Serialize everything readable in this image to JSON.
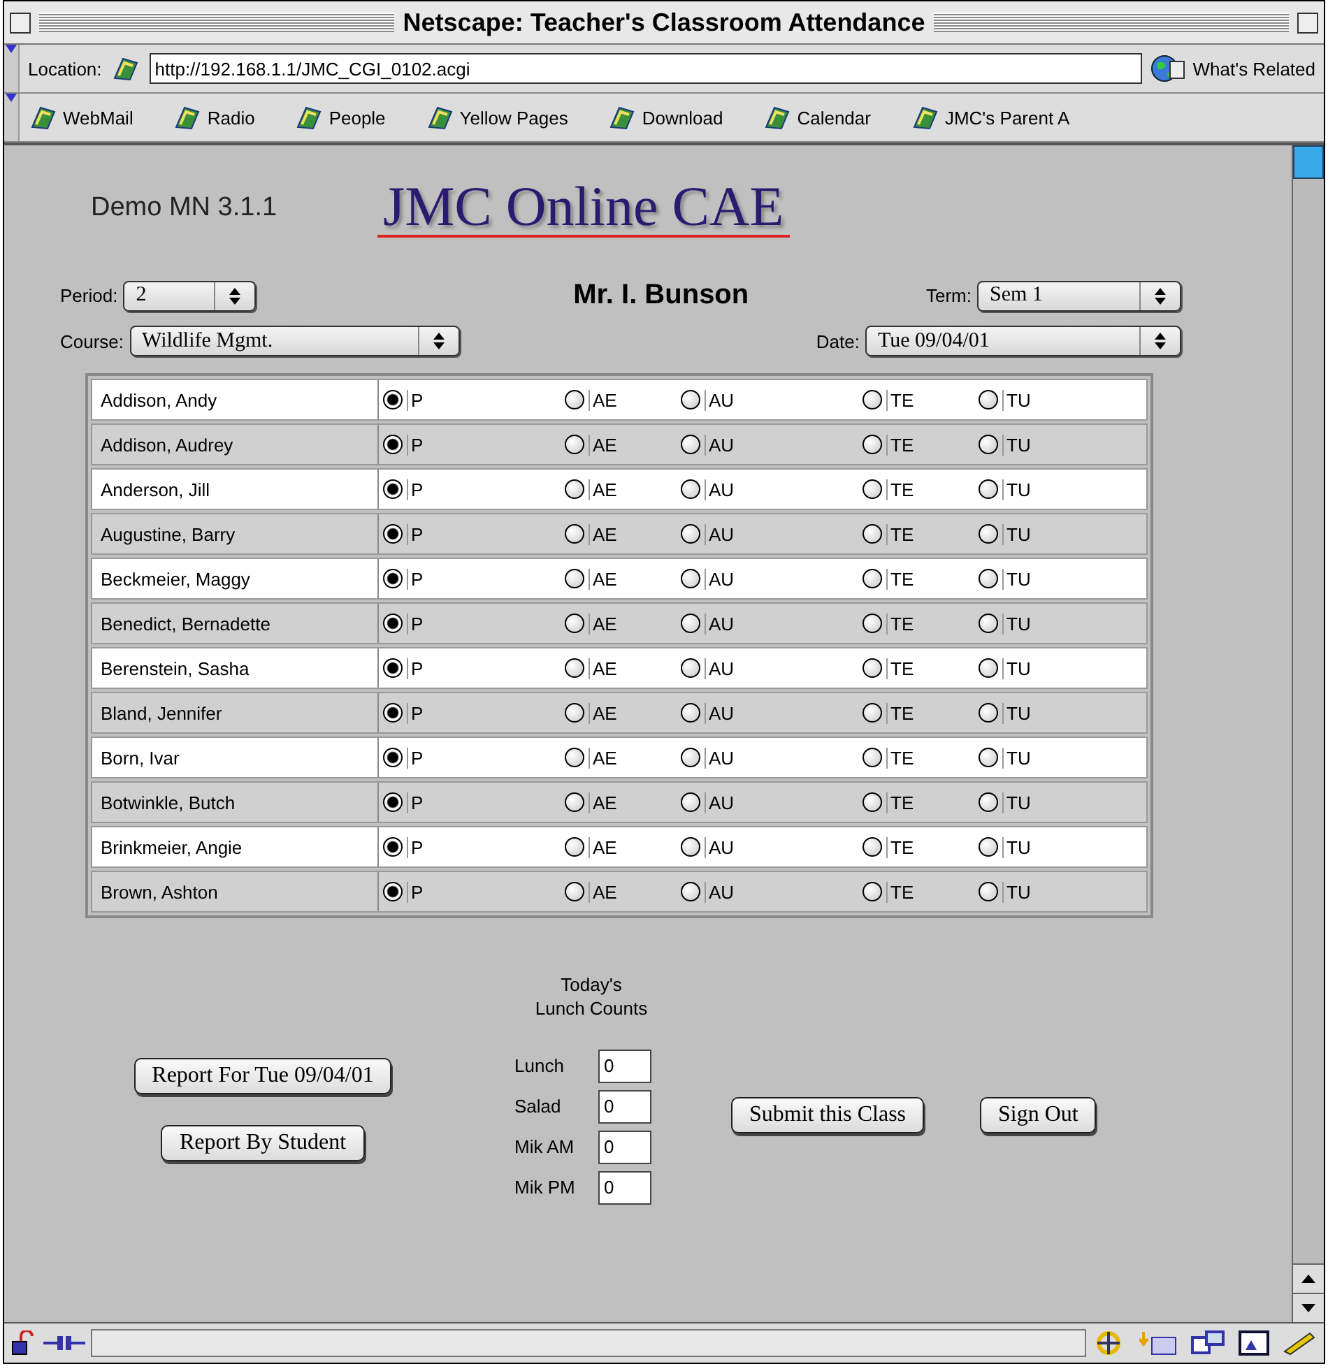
{
  "window": {
    "title": "Netscape: Teacher's Classroom Attendance"
  },
  "location": {
    "label": "Location:",
    "url": "http://192.168.1.1/JMC_CGI_0102.acgi",
    "related": "What's Related"
  },
  "progress": {
    "level": 0
  },
  "bookmarks": [
    "WebMail",
    "Radio",
    "People",
    "Yellow Pages",
    "Download",
    "Calendar",
    "JMC's Parent A"
  ],
  "page": {
    "version": "Demo MN 3.1.1",
    "logo": "JMC Online CAE",
    "teacher": "Mr. I. Bunson",
    "selects": [
      {
        "label": "Period:",
        "value": "2"
      },
      {
        "label": "Term:",
        "value": "Sem 1"
      },
      {
        "label": "Course:",
        "value": "Wildlife Mgmt."
      },
      {
        "label": "Date:",
        "value": "Tue 09/04/01"
      }
    ],
    "students": [
      {
        "name": "Addison, Andy",
        "options": [
          {
            "label": "P",
            "selected": true
          },
          {
            "label": "AE",
            "selected": false
          },
          {
            "label": "AU",
            "selected": false
          },
          {
            "label": "TE",
            "selected": false
          },
          {
            "label": "TU",
            "selected": false
          }
        ]
      },
      {
        "name": "Addison, Audrey",
        "options": [
          {
            "label": "P",
            "selected": true
          },
          {
            "label": "AE",
            "selected": false
          },
          {
            "label": "AU",
            "selected": false
          },
          {
            "label": "TE",
            "selected": false
          },
          {
            "label": "TU",
            "selected": false
          }
        ]
      },
      {
        "name": "Anderson, Jill",
        "options": [
          {
            "label": "P",
            "selected": true
          },
          {
            "label": "AE",
            "selected": false
          },
          {
            "label": "AU",
            "selected": false
          },
          {
            "label": "TE",
            "selected": false
          },
          {
            "label": "TU",
            "selected": false
          }
        ]
      },
      {
        "name": "Augustine, Barry",
        "options": [
          {
            "label": "P",
            "selected": true
          },
          {
            "label": "AE",
            "selected": false
          },
          {
            "label": "AU",
            "selected": false
          },
          {
            "label": "TE",
            "selected": false
          },
          {
            "label": "TU",
            "selected": false
          }
        ]
      },
      {
        "name": "Beckmeier, Maggy",
        "options": [
          {
            "label": "P",
            "selected": true
          },
          {
            "label": "AE",
            "selected": false
          },
          {
            "label": "AU",
            "selected": false
          },
          {
            "label": "TE",
            "selected": false
          },
          {
            "label": "TU",
            "selected": false
          }
        ]
      },
      {
        "name": "Benedict, Bernadette",
        "options": [
          {
            "label": "P",
            "selected": true
          },
          {
            "label": "AE",
            "selected": false
          },
          {
            "label": "AU",
            "selected": false
          },
          {
            "label": "TE",
            "selected": false
          },
          {
            "label": "TU",
            "selected": false
          }
        ]
      },
      {
        "name": "Berenstein, Sasha",
        "options": [
          {
            "label": "P",
            "selected": true
          },
          {
            "label": "AE",
            "selected": false
          },
          {
            "label": "AU",
            "selected": false
          },
          {
            "label": "TE",
            "selected": false
          },
          {
            "label": "TU",
            "selected": false
          }
        ]
      },
      {
        "name": "Bland, Jennifer",
        "options": [
          {
            "label": "P",
            "selected": true
          },
          {
            "label": "AE",
            "selected": false
          },
          {
            "label": "AU",
            "selected": false
          },
          {
            "label": "TE",
            "selected": false
          },
          {
            "label": "TU",
            "selected": false
          }
        ]
      },
      {
        "name": "Born, Ivar",
        "options": [
          {
            "label": "P",
            "selected": true
          },
          {
            "label": "AE",
            "selected": false
          },
          {
            "label": "AU",
            "selected": false
          },
          {
            "label": "TE",
            "selected": false
          },
          {
            "label": "TU",
            "selected": false
          }
        ]
      },
      {
        "name": "Botwinkle, Butch",
        "options": [
          {
            "label": "P",
            "selected": true
          },
          {
            "label": "AE",
            "selected": false
          },
          {
            "label": "AU",
            "selected": false
          },
          {
            "label": "TE",
            "selected": false
          },
          {
            "label": "TU",
            "selected": false
          }
        ]
      },
      {
        "name": "Brinkmeier, Angie",
        "options": [
          {
            "label": "P",
            "selected": true
          },
          {
            "label": "AE",
            "selected": false
          },
          {
            "label": "AU",
            "selected": false
          },
          {
            "label": "TE",
            "selected": false
          },
          {
            "label": "TU",
            "selected": false
          }
        ]
      },
      {
        "name": "Brown, Ashton",
        "options": [
          {
            "label": "P",
            "selected": true
          },
          {
            "label": "AE",
            "selected": false
          },
          {
            "label": "AU",
            "selected": false
          },
          {
            "label": "TE",
            "selected": false
          },
          {
            "label": "TU",
            "selected": false
          }
        ]
      }
    ],
    "lunch_title": "Today's\nLunch Counts",
    "counts": [
      {
        "label": "Lunch",
        "value": "0"
      },
      {
        "label": "Salad",
        "value": "0"
      },
      {
        "label": "Mik AM",
        "value": "0"
      },
      {
        "label": "Mik PM",
        "value": "0"
      }
    ],
    "report_buttons": [
      "Report For Tue 09/04/01",
      "Report By Student"
    ],
    "action_buttons": [
      "Submit this Class",
      "Sign Out"
    ]
  }
}
